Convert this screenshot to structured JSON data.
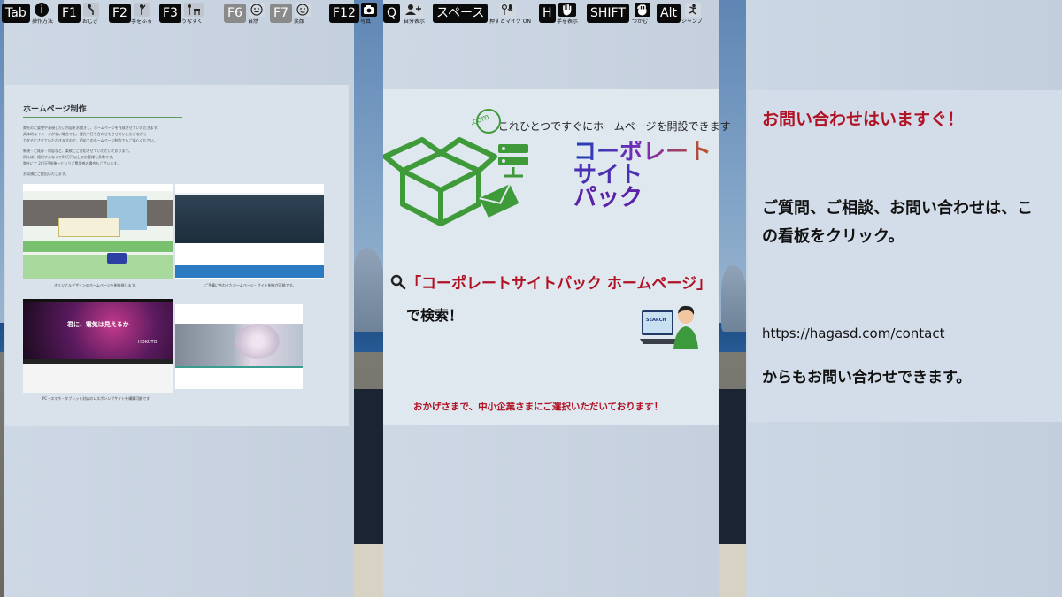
{
  "hud": {
    "keys": [
      {
        "key": "Tab",
        "hint": "操作方法",
        "icon": "info-icon"
      },
      {
        "key": "F1",
        "hint": "おじぎ",
        "icon": "bow-icon"
      },
      {
        "key": "F2",
        "hint": "手をふる",
        "icon": "wave-icon"
      },
      {
        "key": "F3",
        "hint": "うなずく",
        "icon": "nod-icon"
      },
      {
        "key": "F6",
        "hint": "自然",
        "icon": "neutral-face-icon"
      },
      {
        "key": "F7",
        "hint": "笑顔",
        "icon": "smile-face-icon"
      },
      {
        "key": "F12",
        "hint": "写真",
        "icon": "camera-icon"
      },
      {
        "key": "Q",
        "hint": "自分表示",
        "icon": "person-add-icon"
      },
      {
        "key": "スペース",
        "hint": "押すとマイク ON",
        "icon": "mic-icon"
      },
      {
        "key": "H",
        "hint": "手を表示",
        "icon": "hand-icon"
      },
      {
        "key": "SHIFT",
        "hint": "つかむ",
        "icon": "grab-icon"
      },
      {
        "key": "Alt",
        "hint": "ジャンプ",
        "icon": "jump-icon"
      }
    ]
  },
  "left_board": {
    "title": "ホームページ制作",
    "lines": [
      "弊社のご要望や表現したい内容をお聞きし、ホームページを作成させていただきます。",
      "具体的なイメージがない場合でも、優先や打ち合わせをさせていただきながら",
      "カタチにさせていただきますので、初めてのホームページ制作でもご安心ください。",
      "新規・ご既存・内容など、柔軟にご対応させていただいております。",
      "例えば、格別すまなくで60万円以上のお客様も多数です。",
      "弊社にて 20万円前後〜というご費用感の場合もございます。",
      "お見積にご提出いたします。"
    ],
    "captions": [
      "オリジナルデザインのホームページを制作致します。",
      "ご予算に合わせたホームページ・サイト制作が可能です。",
      "PC・スマホ・タブレット対応のレスポンシブサイトを構築可能です。"
    ],
    "shot_text": [
      "君に、電気は見えるか",
      "HOKUTO"
    ]
  },
  "mid_board": {
    "tagline": "これひとつですぐにホームページを開設できます",
    "product": [
      "コーポレート",
      "サイト",
      "パック"
    ],
    "search_phrase": "「コーポレートサイトパック ホームページ」",
    "search_suffix": "で検索！",
    "search_badge": "SEARCH",
    "thanks": "おかげさまで、中小企業さまにご選択いただいております！",
    "com_label": ".com"
  },
  "right_board": {
    "heading": "お問い合わせはいますぐ！",
    "body": "ご質問、ご相談、お問い合わせは、この看板をクリック。",
    "url": "https://hagasd.com/contact",
    "tail": "からもお問い合わせできます。"
  },
  "colors": {
    "accent_red": "#b01224",
    "box_green": "#3f9a3a",
    "product_blue": "#1c3fb8",
    "board_bg": "#dde5ee"
  }
}
